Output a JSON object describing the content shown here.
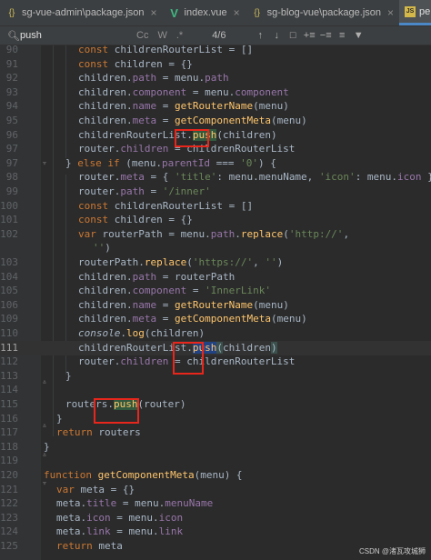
{
  "tabs": [
    {
      "label": "sg-vue-admin\\package.json",
      "icon": "json-file-icon",
      "active": false
    },
    {
      "label": "index.vue",
      "icon": "vue-file-icon",
      "active": false
    },
    {
      "label": "sg-blog-vue\\package.json",
      "icon": "json-file-icon",
      "active": false
    },
    {
      "label": "permission.js",
      "icon": "js-file-icon",
      "active": true
    }
  ],
  "find": {
    "query": "push",
    "match_case": "Cc",
    "words": "W",
    "regex": ".*",
    "count": "4/6"
  },
  "watermark": "CSDN @渚瓦攻城狮",
  "lines": [
    {
      "n": "90",
      "tokens": [
        [
          "kw",
          "const "
        ],
        [
          "id",
          "childrenRouterList = []"
        ]
      ]
    },
    {
      "n": "91",
      "tokens": [
        [
          "kw",
          "const "
        ],
        [
          "id",
          "children = {}"
        ]
      ]
    },
    {
      "n": "92",
      "tokens": [
        [
          "id",
          "children."
        ],
        [
          "prop",
          "path"
        ],
        [
          "id",
          " = menu."
        ],
        [
          "prop",
          "path"
        ]
      ]
    },
    {
      "n": "93",
      "tokens": [
        [
          "id",
          "children."
        ],
        [
          "prop",
          "component"
        ],
        [
          "id",
          " = menu."
        ],
        [
          "prop",
          "component"
        ]
      ]
    },
    {
      "n": "94",
      "tokens": [
        [
          "id",
          "children."
        ],
        [
          "prop",
          "name"
        ],
        [
          "id",
          " = "
        ],
        [
          "fn",
          "getRouterName"
        ],
        [
          "id",
          "(menu)"
        ]
      ]
    },
    {
      "n": "95",
      "tokens": [
        [
          "id",
          "children."
        ],
        [
          "prop",
          "meta"
        ],
        [
          "id",
          " = "
        ],
        [
          "fn",
          "getComponentMeta"
        ],
        [
          "id",
          "(menu)"
        ]
      ]
    },
    {
      "n": "96",
      "tokens": [
        [
          "id",
          "childrenRouterList."
        ],
        [
          "match",
          "push"
        ],
        [
          "id",
          "(children)"
        ]
      ]
    },
    {
      "n": "97",
      "tokens": [
        [
          "id",
          "router."
        ],
        [
          "prop",
          "children"
        ],
        [
          "id",
          " = childrenRouterList"
        ]
      ]
    },
    {
      "n": "97b",
      "tokens": [
        [
          "id",
          "} "
        ],
        [
          "kw",
          "else if "
        ],
        [
          "id",
          "(menu."
        ],
        [
          "prop",
          "parentId"
        ],
        [
          "id",
          " === "
        ],
        [
          "str",
          "'0'"
        ],
        [
          "id",
          ") {"
        ]
      ]
    },
    {
      "n": "98",
      "tokens": [
        [
          "id",
          "router."
        ],
        [
          "prop",
          "meta"
        ],
        [
          "id",
          " = { "
        ],
        [
          "str",
          "'title'"
        ],
        [
          "id",
          ": menu.menuName, "
        ],
        [
          "str",
          "'icon'"
        ],
        [
          "id",
          ": menu."
        ],
        [
          "prop",
          "icon"
        ],
        [
          "id",
          " }"
        ]
      ]
    },
    {
      "n": "99",
      "tokens": [
        [
          "id",
          "router."
        ],
        [
          "prop",
          "path"
        ],
        [
          "id",
          " = "
        ],
        [
          "str",
          "'/inner'"
        ]
      ]
    },
    {
      "n": "100",
      "tokens": [
        [
          "kw",
          "const "
        ],
        [
          "id",
          "childrenRouterList = []"
        ]
      ]
    },
    {
      "n": "101",
      "tokens": [
        [
          "kw",
          "const "
        ],
        [
          "id",
          "children = {}"
        ]
      ]
    },
    {
      "n": "102",
      "tokens": [
        [
          "kw",
          "var "
        ],
        [
          "id",
          "routerPath = menu."
        ],
        [
          "prop",
          "path"
        ],
        [
          "id",
          "."
        ],
        [
          "fn",
          "replace"
        ],
        [
          "id",
          "("
        ],
        [
          "str",
          "'http://'"
        ],
        [
          "id",
          ","
        ]
      ]
    },
    {
      "n": "",
      "tokens": [
        [
          "str",
          "''"
        ],
        [
          "id",
          ")"
        ]
      ]
    },
    {
      "n": "103",
      "tokens": [
        [
          "id",
          "routerPath."
        ],
        [
          "fn",
          "replace"
        ],
        [
          "id",
          "("
        ],
        [
          "str",
          "'https://'"
        ],
        [
          "id",
          ", "
        ],
        [
          "str",
          "''"
        ],
        [
          "id",
          ")"
        ]
      ]
    },
    {
      "n": "104",
      "tokens": [
        [
          "id",
          "children."
        ],
        [
          "prop",
          "path"
        ],
        [
          "id",
          " = routerPath"
        ]
      ]
    },
    {
      "n": "105",
      "tokens": [
        [
          "id",
          "children."
        ],
        [
          "prop",
          "component"
        ],
        [
          "id",
          " = "
        ],
        [
          "str",
          "'InnerLink'"
        ]
      ]
    },
    {
      "n": "106",
      "tokens": [
        [
          "id",
          "children."
        ],
        [
          "prop",
          "name"
        ],
        [
          "id",
          " = "
        ],
        [
          "fn",
          "getRouterName"
        ],
        [
          "id",
          "(menu)"
        ]
      ]
    },
    {
      "n": "109",
      "tokens": [
        [
          "id",
          "children."
        ],
        [
          "prop",
          "meta"
        ],
        [
          "id",
          " = "
        ],
        [
          "fn",
          "getComponentMeta"
        ],
        [
          "id",
          "(menu)"
        ]
      ]
    },
    {
      "n": "110",
      "tokens": [
        [
          "it",
          "console"
        ],
        [
          "id",
          "."
        ],
        [
          "fn",
          "log"
        ],
        [
          "id",
          "(children)"
        ]
      ]
    },
    {
      "n": "111",
      "tokens": [
        [
          "id",
          "childrenRouterList."
        ],
        [
          "matchcur",
          "push"
        ],
        [
          "paren",
          "("
        ],
        [
          "id",
          "children"
        ],
        [
          "paren",
          ")"
        ]
      ]
    },
    {
      "n": "112",
      "tokens": [
        [
          "id",
          "router."
        ],
        [
          "prop",
          "children"
        ],
        [
          "id",
          " = childrenRouterList"
        ]
      ]
    },
    {
      "n": "113",
      "tokens": [
        [
          "id",
          "}"
        ]
      ]
    },
    {
      "n": "114",
      "tokens": []
    },
    {
      "n": "115",
      "tokens": [
        [
          "id",
          "routers."
        ],
        [
          "match",
          "push"
        ],
        [
          "id",
          "(router)"
        ]
      ]
    },
    {
      "n": "116",
      "tokens": [
        [
          "id",
          "}"
        ]
      ]
    },
    {
      "n": "117",
      "tokens": [
        [
          "kw",
          "return "
        ],
        [
          "id",
          "routers"
        ]
      ]
    },
    {
      "n": "118",
      "tokens": [
        [
          "id",
          "}"
        ]
      ]
    },
    {
      "n": "119",
      "tokens": []
    },
    {
      "n": "120",
      "tokens": [
        [
          "kw",
          "function "
        ],
        [
          "fn",
          "getComponentMeta"
        ],
        [
          "id",
          "(menu) {"
        ]
      ]
    },
    {
      "n": "121",
      "tokens": [
        [
          "kw",
          "var "
        ],
        [
          "id",
          "meta = {}"
        ]
      ]
    },
    {
      "n": "122",
      "tokens": [
        [
          "id",
          "meta."
        ],
        [
          "prop",
          "title"
        ],
        [
          "id",
          " = menu."
        ],
        [
          "prop",
          "menuName"
        ]
      ]
    },
    {
      "n": "123",
      "tokens": [
        [
          "id",
          "meta."
        ],
        [
          "prop",
          "icon"
        ],
        [
          "id",
          " = menu."
        ],
        [
          "prop",
          "icon"
        ]
      ]
    },
    {
      "n": "124",
      "tokens": [
        [
          "id",
          "meta."
        ],
        [
          "prop",
          "link"
        ],
        [
          "id",
          " = menu."
        ],
        [
          "prop",
          "link"
        ]
      ]
    },
    {
      "n": "125",
      "tokens": [
        [
          "kw",
          "return "
        ],
        [
          "id",
          "meta"
        ]
      ]
    }
  ]
}
